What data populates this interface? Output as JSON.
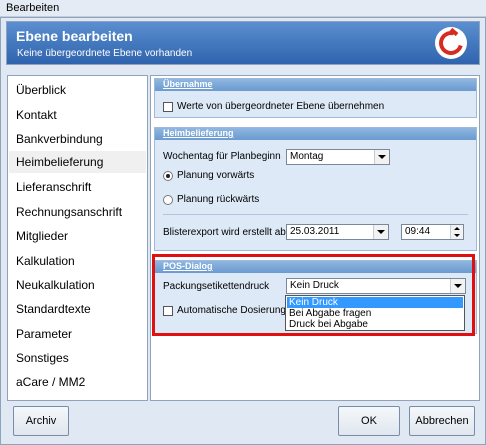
{
  "window": {
    "title": "Bearbeiten"
  },
  "header": {
    "title": "Ebene bearbeiten",
    "subtitle": "Keine übergeordnete Ebene vorhanden",
    "logo": "red-circle-logo"
  },
  "sidebar": {
    "items": [
      {
        "label": "Überblick"
      },
      {
        "label": "Kontakt"
      },
      {
        "label": "Bankverbindung"
      },
      {
        "label": "Heimbelieferung",
        "selected": true
      },
      {
        "label": "Lieferanschrift"
      },
      {
        "label": "Rechnungsanschrift"
      },
      {
        "label": "Mitglieder"
      },
      {
        "label": "Kalkulation"
      },
      {
        "label": "Neukalkulation"
      },
      {
        "label": "Standardtexte"
      },
      {
        "label": "Parameter"
      },
      {
        "label": "Sonstiges"
      },
      {
        "label": "aCare / MM2"
      }
    ]
  },
  "uebernahme": {
    "header": "Übernahme",
    "checkbox_label": "Werte von übergeordneter Ebene übernehmen",
    "checked": false
  },
  "heim": {
    "header": "Heimbelieferung",
    "weekday_label": "Wochentag für Planbeginn",
    "weekday_value": "Montag",
    "radio_forward": "Planung vorwärts",
    "radio_backward": "Planung rückwärts",
    "selected_radio": "forward",
    "blister_label": "Blisterexport wird erstellt ab:",
    "blister_date": "25.03.2011",
    "blister_time": "09:44"
  },
  "pos": {
    "header": "POS-Dialog",
    "label_print_label": "Packungsetikettendruck",
    "label_print_value": "Kein Druck",
    "dosing_label": "Automatische Dosierungs",
    "dosing_checked": false,
    "options": [
      "Kein Druck",
      "Bei Abgabe fragen",
      "Druck bei Abgabe"
    ],
    "highlight_color": "#e01010"
  },
  "buttons": {
    "archive": "Archiv",
    "ok": "OK",
    "cancel": "Abbrechen"
  },
  "colors": {
    "header_blue": "#2f63ad",
    "group_header": "#6a9ad0",
    "selection": "#3399ff",
    "logo_red": "#d62b20"
  }
}
